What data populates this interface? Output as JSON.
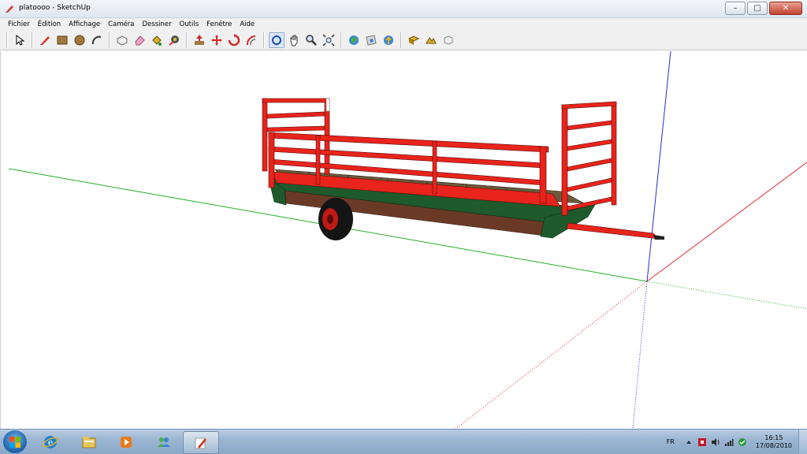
{
  "window": {
    "title": "platoooo - SketchUp",
    "minimize_glyph": "–",
    "maximize_glyph": "□",
    "close_glyph": "✕"
  },
  "menu": {
    "items": [
      "Fichier",
      "Édition",
      "Affichage",
      "Caméra",
      "Dessiner",
      "Outils",
      "Fenêtre",
      "Aide"
    ]
  },
  "toolbar": {
    "tools": [
      "select-icon",
      "pencil-icon",
      "rectangle-icon",
      "circle-icon",
      "arc-icon",
      "make-component-icon",
      "eraser-icon",
      "paint-bucket-icon",
      "tape-measure-icon",
      "push-pull-icon",
      "move-icon",
      "rotate-icon",
      "offset-icon",
      "orbit-icon",
      "pan-icon",
      "zoom-icon",
      "zoom-extents-icon",
      "get-models-icon",
      "share-model-icon",
      "upload-icon",
      "add-location-icon",
      "toggle-terrain-icon",
      "google-earth-icon"
    ],
    "active_tool": "orbit-icon"
  },
  "taskbar": {
    "apps": [
      "internet-explorer-icon",
      "file-explorer-icon",
      "media-player-icon",
      "messenger-icon",
      "sketchup-icon"
    ],
    "active_app": "sketchup-icon",
    "language": "FR",
    "time": "16:15",
    "date": "17/08/2010"
  },
  "colors": {
    "frame_red": "#e8241c",
    "chassis_green": "#1f5a2c",
    "deck_wood": "#6b5a3a",
    "axis_red": "#e03030",
    "axis_green": "#22b022",
    "axis_blue": "#2a2ad0"
  }
}
